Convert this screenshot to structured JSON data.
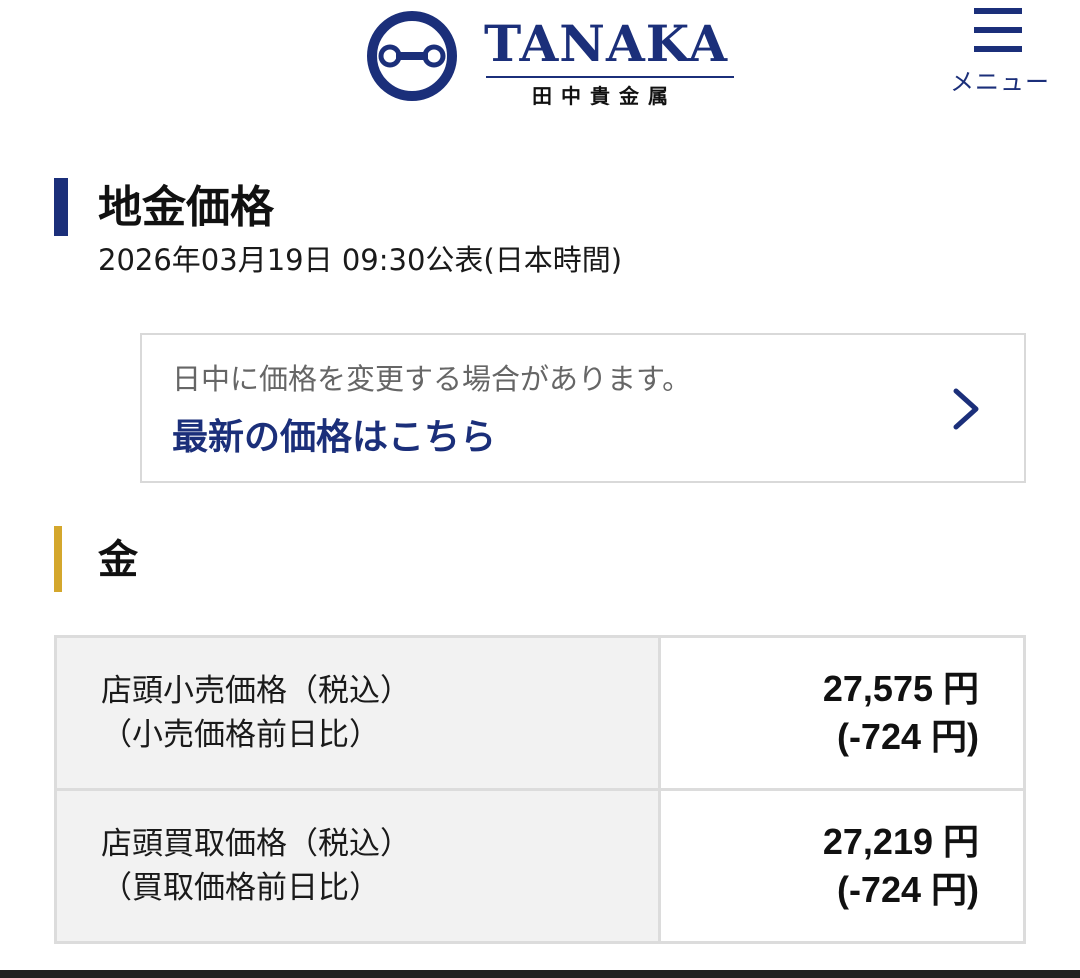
{
  "header": {
    "brand_name": "TANAKA",
    "brand_subtitle": "田中貴金属",
    "menu_label": "メニュー",
    "brand_color": "#1b2f7a"
  },
  "page": {
    "title": "地金価格",
    "published": "2026年03月19日 09:30公表(日本時間)"
  },
  "notice": {
    "note": "日中に価格を変更する場合があります。",
    "link_label": "最新の価格はこちら",
    "chevron_icon": "chevron-right-icon"
  },
  "gold": {
    "section_title": "金",
    "accent_color": "#d4a72c",
    "rows": [
      {
        "label_line1": "店頭小売価格（税込）",
        "label_line2": "（小売価格前日比）",
        "price": "27,575 円",
        "change": "(-724 円)"
      },
      {
        "label_line1": "店頭買取価格（税込）",
        "label_line2": "（買取価格前日比）",
        "price": "27,219 円",
        "change": "(-724 円)"
      }
    ]
  }
}
